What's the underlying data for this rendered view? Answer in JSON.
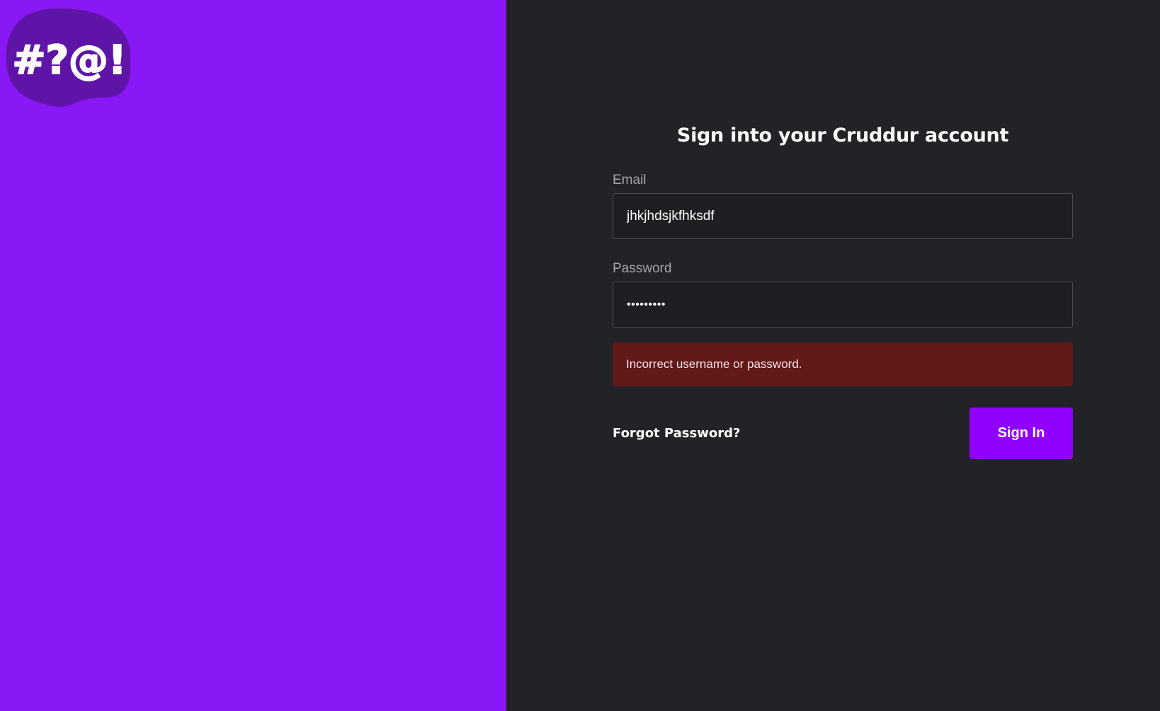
{
  "theme": {
    "brand_purple": "#8A17F5",
    "button_purple": "#9100FF",
    "panel_dark": "#212327",
    "input_bg": "#1E1F22",
    "error_bg": "#63181A"
  },
  "logo": {
    "icon": "speech-bubble-logo",
    "text": "#?@!"
  },
  "signin": {
    "title": "Sign into your Cruddur account",
    "email_label": "Email",
    "email_value": "jhkjhdsjkfhksdf",
    "password_label": "Password",
    "password_value": "sdfsdfsdf",
    "error_message": "Incorrect username or password.",
    "forgot_label": "Forgot Password?",
    "submit_label": "Sign In"
  }
}
